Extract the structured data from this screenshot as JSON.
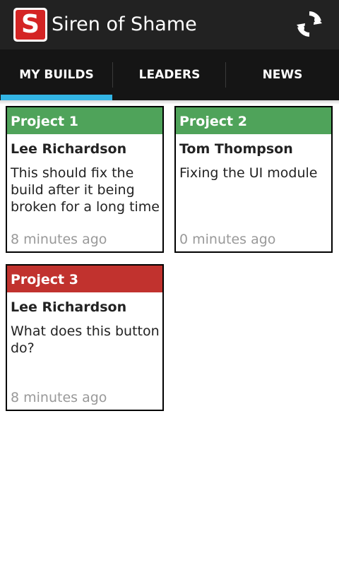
{
  "app": {
    "title": "Siren of Shame",
    "icon_letter": "S",
    "icon": "siren-of-shame-logo",
    "refresh_icon": "refresh-icon"
  },
  "tabs": [
    {
      "label": "MY BUILDS",
      "selected": true
    },
    {
      "label": "LEADERS",
      "selected": false
    },
    {
      "label": "NEWS",
      "selected": false
    }
  ],
  "colors": {
    "success": "#4fa35a",
    "failure": "#c1322e",
    "tab_indicator": "#33b5e5"
  },
  "builds": [
    {
      "project": "Project 1",
      "author": "Lee Richardson",
      "message": "This should fix the build after it being broken for a long time",
      "time": "8 minutes ago",
      "status": "success"
    },
    {
      "project": "Project 2",
      "author": "Tom Thompson",
      "message": "Fixing the UI module",
      "time": "0 minutes ago",
      "status": "success"
    },
    {
      "project": "Project 3",
      "author": "Lee Richardson",
      "message": "What does this button do?",
      "time": "8 minutes ago",
      "status": "failure"
    }
  ]
}
